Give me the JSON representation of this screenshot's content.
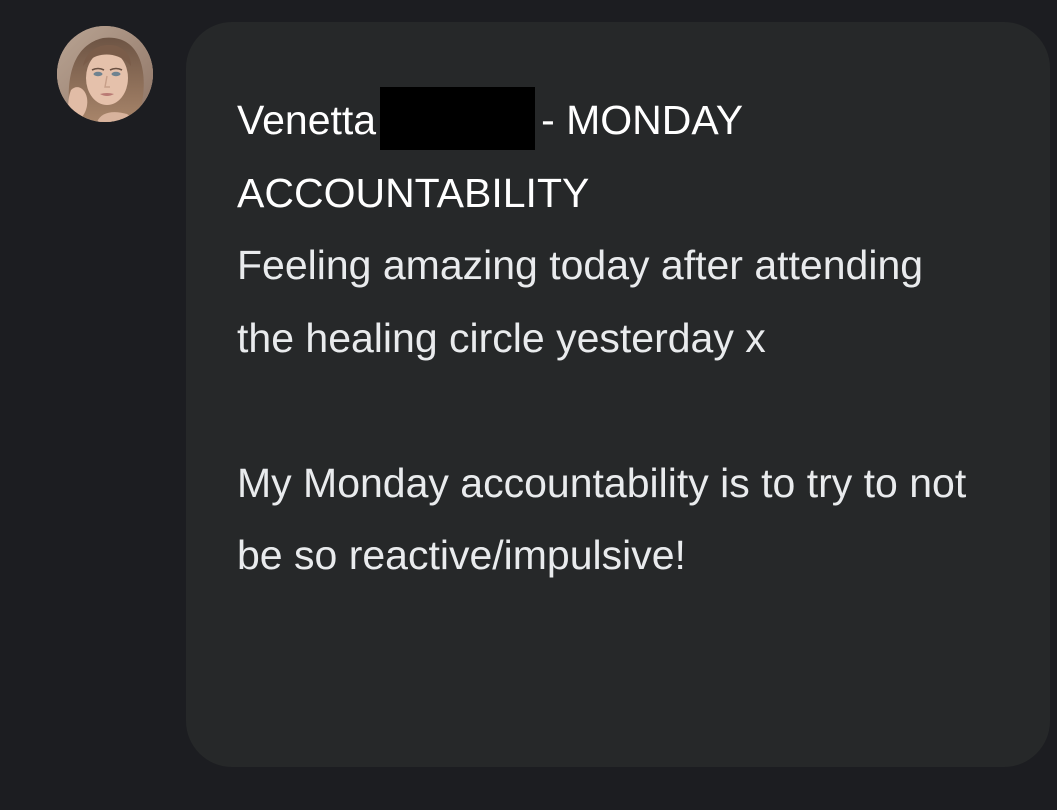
{
  "sender": {
    "avatar_icon": "profile-photo",
    "name": "Venetta",
    "name_redacted": true
  },
  "message": {
    "heading_suffix": "- MONDAY ACCOUNTABILITY",
    "paragraph1": "Feeling amazing today after attending the healing circle yesterday x",
    "paragraph2": "My Monday accountability is to try to not be so reactive/impulsive!"
  },
  "colors": {
    "background": "#1c1d21",
    "bubble": "#262829",
    "text": "#e9ebed",
    "redaction": "#000000"
  }
}
